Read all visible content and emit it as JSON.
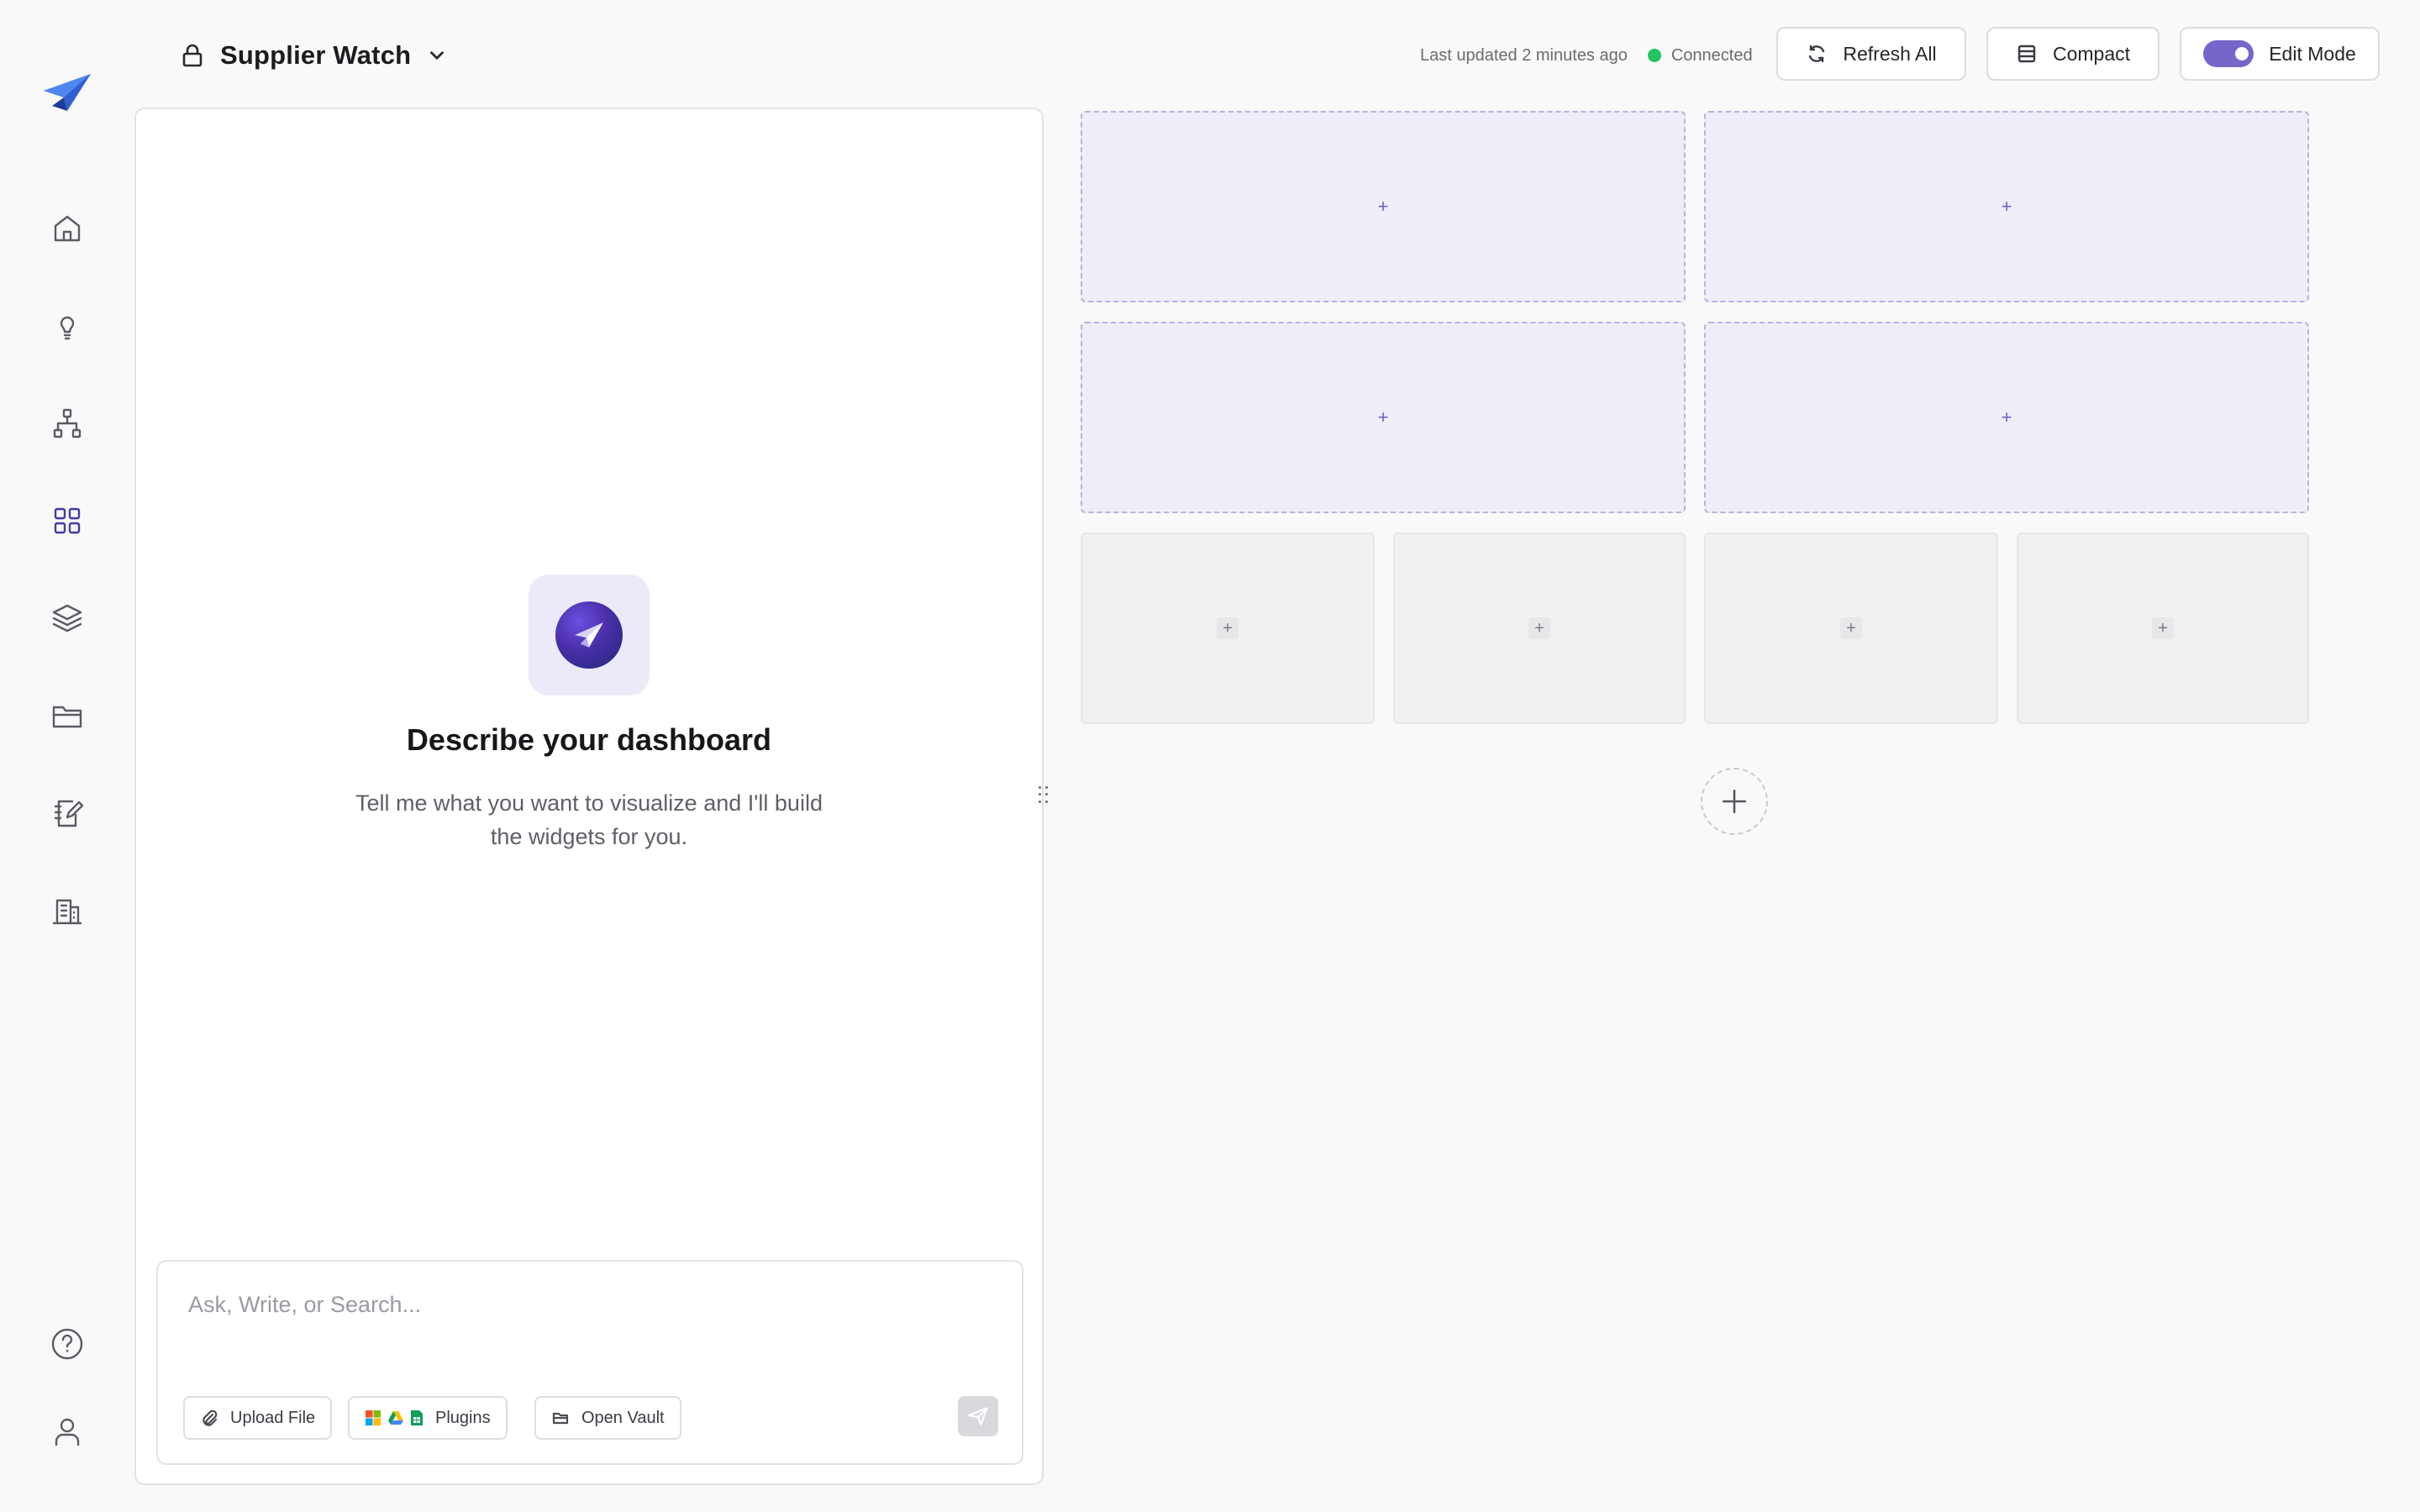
{
  "header": {
    "dashboard_title": "Supplier Watch",
    "last_updated": "Last updated 2 minutes ago",
    "connection_status": "Connected",
    "refresh_label": "Refresh All",
    "compact_label": "Compact",
    "edit_mode_label": "Edit Mode",
    "edit_mode_on": true
  },
  "nav": {
    "items": [
      "home-icon",
      "lightbulb-icon",
      "hierarchy-icon",
      "grid-icon",
      "layers-icon",
      "folder-icon",
      "notebook-edit-icon",
      "building-icon"
    ],
    "active": "grid-icon",
    "bottom": [
      "help-icon",
      "user-icon"
    ]
  },
  "chat": {
    "empty_title": "Describe your dashboard",
    "empty_subtitle": "Tell me what you want to visualize and I'll build the widgets for you.",
    "input_placeholder": "Ask, Write, or Search...",
    "upload_label": "Upload File",
    "plugins_label": "Plugins",
    "vault_label": "Open Vault"
  },
  "widgets": {
    "large_slot_count": 4,
    "small_slot_count": 4,
    "plus_symbol": "+"
  },
  "colors": {
    "accent": "#7765c9",
    "active_nav": "#3f3aa8",
    "status_connected": "#22c55e",
    "large_slot_bg": "#efedf8",
    "small_slot_bg": "#f1f1f2"
  }
}
